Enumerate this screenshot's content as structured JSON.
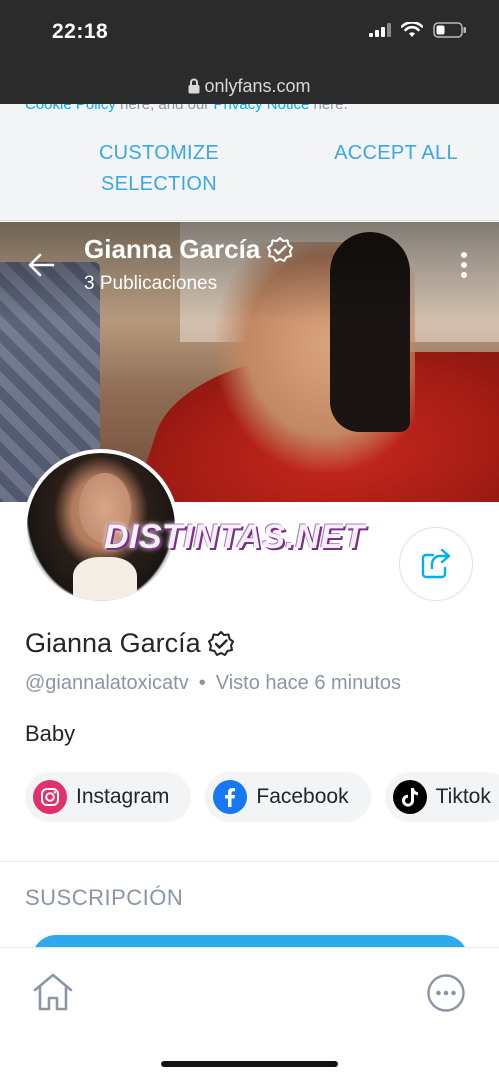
{
  "status": {
    "time": "22:18",
    "url": "onlyfans.com"
  },
  "cookie_banner": {
    "text_link1": "Cookie Policy",
    "text_mid": " here, and our ",
    "text_link2": "Privacy Notice",
    "text_end": " here.",
    "customize_label": "CUSTOMIZE SELECTION",
    "accept_label": "ACCEPT ALL"
  },
  "header": {
    "name": "Gianna García",
    "posts": "3 Publicaciones"
  },
  "watermark": "DISTINTAS.NET",
  "profile": {
    "name": "Gianna García",
    "handle": "@giannalatoxicatv",
    "separator": "•",
    "last_seen": "Visto hace 6 minutos",
    "bio": "Baby"
  },
  "socials": [
    {
      "label": "Instagram",
      "icon": "instagram-icon"
    },
    {
      "label": "Facebook",
      "icon": "facebook-icon"
    },
    {
      "label": "Tiktok",
      "icon": "tiktok-icon"
    }
  ],
  "subscription": {
    "title": "SUSCRIPCIÓN"
  },
  "colors": {
    "accent": "#00aff0",
    "muted": "#8a96a3",
    "text": "#242529"
  }
}
